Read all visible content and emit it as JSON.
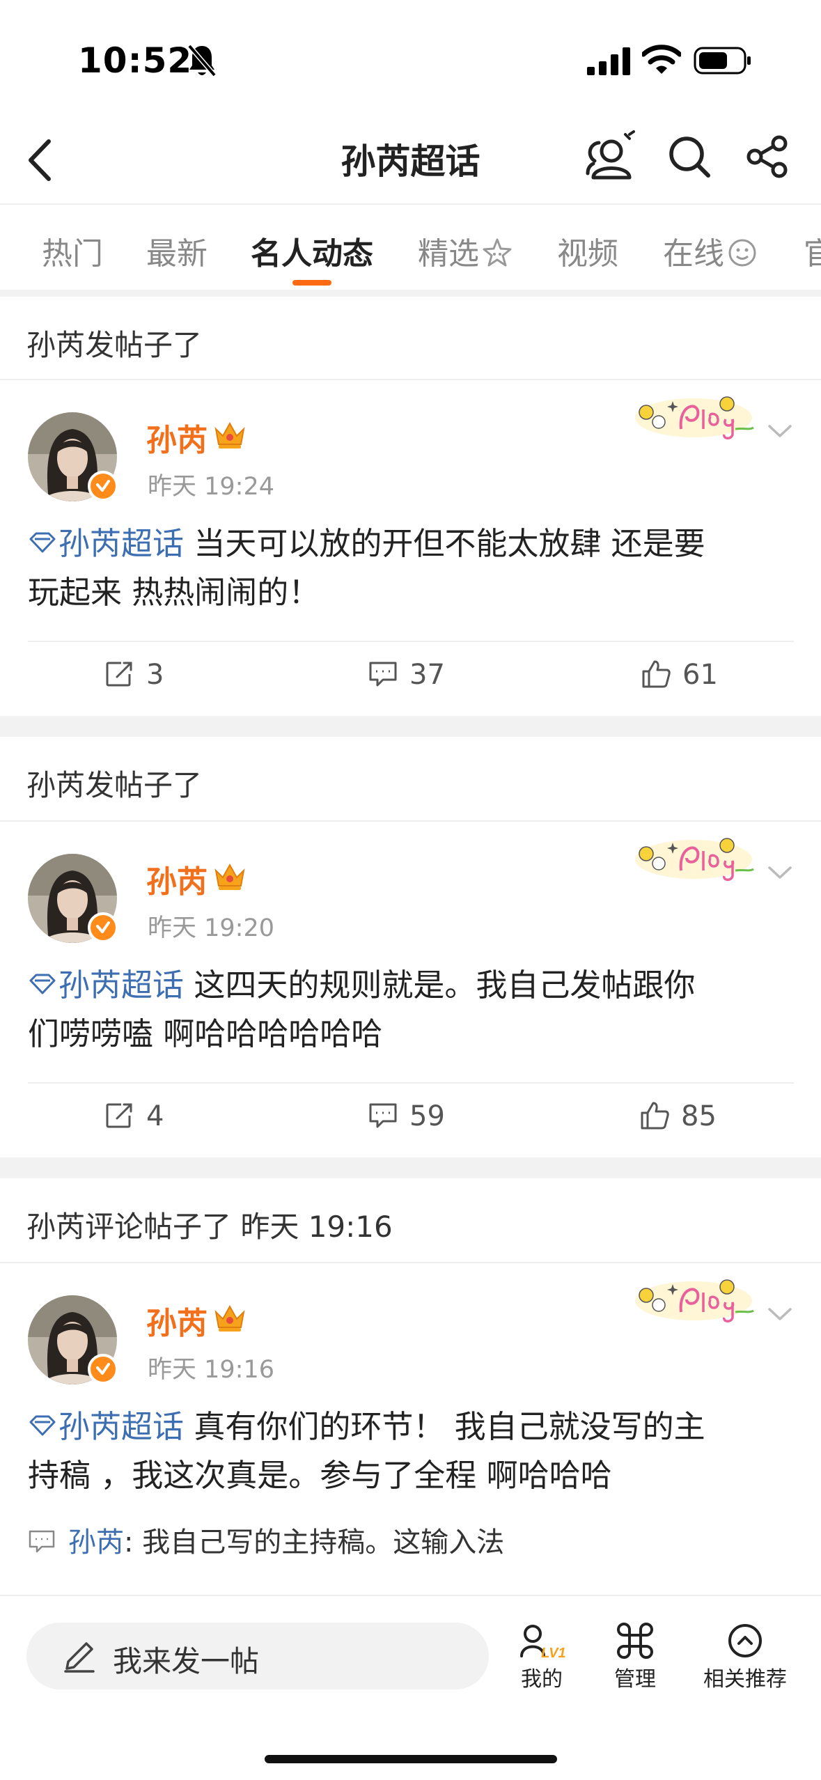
{
  "status_bar": {
    "time": "10:52"
  },
  "nav": {
    "title": "孙芮超话"
  },
  "tabs": [
    {
      "label": "热门",
      "active": false
    },
    {
      "label": "最新",
      "active": false
    },
    {
      "label": "名人动态",
      "active": true
    },
    {
      "label": "精选",
      "active": false
    },
    {
      "label": "视频",
      "active": false
    },
    {
      "label": "在线",
      "active": false
    },
    {
      "label": "官",
      "active": false
    }
  ],
  "posts": [
    {
      "header": "孙芮发帖子了",
      "author": "孙芮",
      "time": "昨天 19:24",
      "topic": "孙芮超话",
      "text_line1": " 当天可以放的开但不能太放肆  还是要",
      "text_line2": "玩起来 热热闹闹的！",
      "reposts": "3",
      "comments": "37",
      "likes": "61"
    },
    {
      "header": "孙芮发帖子了",
      "author": "孙芮",
      "time": "昨天 19:20",
      "topic": "孙芮超话",
      "text_line1": " 这四天的规则就是。我自己发帖跟你",
      "text_line2": "们唠唠嗑 啊哈哈哈哈哈哈",
      "reposts": "4",
      "comments": "59",
      "likes": "85"
    },
    {
      "header": "孙芮评论帖子了 昨天 19:16",
      "author": "孙芮",
      "time": "昨天 19:16",
      "topic": "孙芮超话",
      "text_line1": " 真有你们的环节！  我自己就没写的主",
      "text_line2": "持稿 ，我这次真是。参与了全程 啊哈哈哈",
      "comment_author": "孙芮",
      "comment_text": ": 我自己写的主持稿。这输入法"
    }
  ],
  "bottom": {
    "compose_label": "我来发一帖",
    "mine_label": "我的",
    "manage_label": "管理",
    "recommend_label": "相关推荐",
    "level_badge": "LV1"
  },
  "colors": {
    "accent": "#ff6a12",
    "name": "#f26f1c",
    "link": "#3d6eb2"
  }
}
